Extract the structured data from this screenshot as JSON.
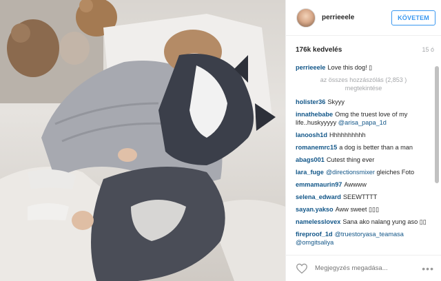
{
  "post": {
    "username": "perrieeele",
    "follow_label": "KÖVETEM",
    "likes": "176k kedvelés",
    "time": "15 ó",
    "load_more": "az összes hozzászólás (2,853 ) megtekintése",
    "comment_placeholder": "Megjegyzés megadása...",
    "more_glyph": "•••",
    "caption": {
      "user": "perrieeele",
      "text": "Love this dog! ▯"
    }
  },
  "comments": [
    {
      "user": "holister36",
      "text": "Skyyy",
      "mention": ""
    },
    {
      "user": "innathebabe",
      "text": "Omg the truest love of my life..huskyyyyy ",
      "mention": "@arisa_papa_1d"
    },
    {
      "user": "lanoosh1d",
      "text": "Hhhhhhhhhh",
      "mention": ""
    },
    {
      "user": "romanemrc15",
      "text": "a dog is better than a man",
      "mention": ""
    },
    {
      "user": "abags001",
      "text": "Cutest thing ever",
      "mention": ""
    },
    {
      "user": "lara_fuge",
      "text": " gleiches Foto",
      "mention": "@directionsmixer"
    },
    {
      "user": "emmamaurin97",
      "text": "Awwww",
      "mention": ""
    },
    {
      "user": "selena_edward",
      "text": "SEEWTTTT",
      "mention": ""
    },
    {
      "user": "sayan.yakso",
      "text": "Aww sweet ▯▯▯",
      "mention": ""
    },
    {
      "user": "namelesslovex",
      "text": "Sana ako nalang yung aso ▯▯",
      "mention": ""
    },
    {
      "user": "fireproof_1d",
      "text": " ",
      "mention": "@truestoryasa_teamasa @omgitsaliya"
    }
  ],
  "icons": {
    "heart": "heart-outline-icon",
    "avatar": "avatar"
  },
  "colors": {
    "accent": "#3897f0",
    "username": "#125688",
    "muted": "#a5a7aa"
  }
}
